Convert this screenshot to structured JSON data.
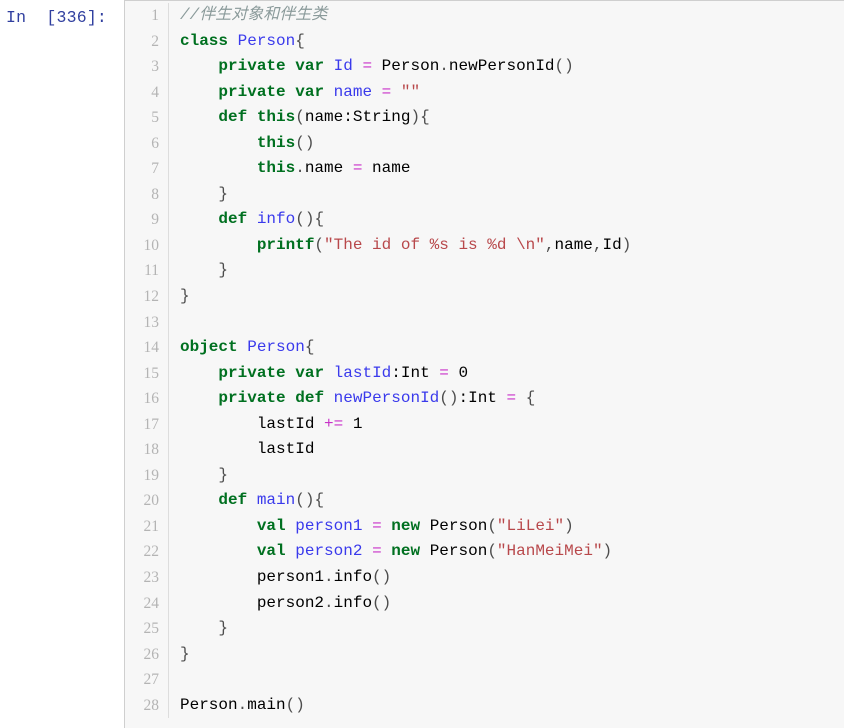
{
  "cell": {
    "prompt": "In  [336]:",
    "language": "scala",
    "line_count": 28,
    "colors": {
      "cell_background": "#f7f7f7",
      "page_background": "#ffffff",
      "prompt_color": "#303F9F",
      "gutter_text": "#b4b4b4",
      "gutter_border": "#dddddd",
      "cell_border": "#cfcfcf",
      "comment": "#8a9a9a",
      "keyword": "#007020",
      "builtin": "#007020",
      "name": "#3a3aec",
      "string": "#b8484b",
      "operator": "#c832c8",
      "plain": "#000000",
      "brace": "#4d4d4d"
    }
  },
  "line_numbers": [
    "1",
    "2",
    "3",
    "4",
    "5",
    "6",
    "7",
    "8",
    "9",
    "10",
    "11",
    "12",
    "13",
    "14",
    "15",
    "16",
    "17",
    "18",
    "19",
    "20",
    "21",
    "22",
    "23",
    "24",
    "25",
    "26",
    "27",
    "28"
  ],
  "code": {
    "plain_text": "//伴生对象和伴生类\nclass Person{\n    private var Id = Person.newPersonId()\n    private var name = \"\"\n    def this(name:String){\n        this()\n        this.name = name\n    }\n    def info(){\n        printf(\"The id of %s is %d \\n\",name,Id)\n    }\n}\n\nobject Person{\n    private var lastId:Int = 0\n    private def newPersonId():Int = {\n        lastId += 1\n        lastId\n    }\n    def main(){\n        val person1 = new Person(\"LiLei\")\n        val person2 = new Person(\"HanMeiMei\")\n        person1.info()\n        person2.info()\n    }\n}\n\nPerson.main()",
    "lines": [
      {
        "n": 1,
        "tokens": [
          {
            "t": "comment",
            "v": "//伴生对象和伴生类"
          }
        ]
      },
      {
        "n": 2,
        "tokens": [
          {
            "t": "keyword",
            "v": "class"
          },
          {
            "t": "plain",
            "v": " "
          },
          {
            "t": "class",
            "v": "Person"
          },
          {
            "t": "brace",
            "v": "{"
          }
        ]
      },
      {
        "n": 3,
        "tokens": [
          {
            "t": "plain",
            "v": "    "
          },
          {
            "t": "keyword",
            "v": "private"
          },
          {
            "t": "plain",
            "v": " "
          },
          {
            "t": "keyword",
            "v": "var"
          },
          {
            "t": "plain",
            "v": " "
          },
          {
            "t": "name",
            "v": "Id"
          },
          {
            "t": "plain",
            "v": " "
          },
          {
            "t": "operator",
            "v": "="
          },
          {
            "t": "plain",
            "v": " Person"
          },
          {
            "t": "punct",
            "v": "."
          },
          {
            "t": "plain",
            "v": "newPersonId"
          },
          {
            "t": "brace",
            "v": "()"
          }
        ]
      },
      {
        "n": 4,
        "tokens": [
          {
            "t": "plain",
            "v": "    "
          },
          {
            "t": "keyword",
            "v": "private"
          },
          {
            "t": "plain",
            "v": " "
          },
          {
            "t": "keyword",
            "v": "var"
          },
          {
            "t": "plain",
            "v": " "
          },
          {
            "t": "name",
            "v": "name"
          },
          {
            "t": "plain",
            "v": " "
          },
          {
            "t": "operator",
            "v": "="
          },
          {
            "t": "plain",
            "v": " "
          },
          {
            "t": "string",
            "v": "\"\""
          }
        ]
      },
      {
        "n": 5,
        "tokens": [
          {
            "t": "plain",
            "v": "    "
          },
          {
            "t": "keyword",
            "v": "def"
          },
          {
            "t": "plain",
            "v": " "
          },
          {
            "t": "keyword",
            "v": "this"
          },
          {
            "t": "brace",
            "v": "("
          },
          {
            "t": "plain",
            "v": "name:String"
          },
          {
            "t": "brace",
            "v": ")"
          },
          {
            "t": "brace",
            "v": "{"
          }
        ]
      },
      {
        "n": 6,
        "tokens": [
          {
            "t": "plain",
            "v": "        "
          },
          {
            "t": "keyword",
            "v": "this"
          },
          {
            "t": "brace",
            "v": "()"
          }
        ]
      },
      {
        "n": 7,
        "tokens": [
          {
            "t": "plain",
            "v": "        "
          },
          {
            "t": "keyword",
            "v": "this"
          },
          {
            "t": "punct",
            "v": "."
          },
          {
            "t": "plain",
            "v": "name "
          },
          {
            "t": "operator",
            "v": "="
          },
          {
            "t": "plain",
            "v": " name"
          }
        ]
      },
      {
        "n": 8,
        "tokens": [
          {
            "t": "plain",
            "v": "    "
          },
          {
            "t": "brace",
            "v": "}"
          }
        ]
      },
      {
        "n": 9,
        "tokens": [
          {
            "t": "plain",
            "v": "    "
          },
          {
            "t": "keyword",
            "v": "def"
          },
          {
            "t": "plain",
            "v": " "
          },
          {
            "t": "name",
            "v": "info"
          },
          {
            "t": "brace",
            "v": "()"
          },
          {
            "t": "brace",
            "v": "{"
          }
        ]
      },
      {
        "n": 10,
        "tokens": [
          {
            "t": "plain",
            "v": "        "
          },
          {
            "t": "builtin",
            "v": "printf"
          },
          {
            "t": "brace",
            "v": "("
          },
          {
            "t": "string",
            "v": "\"The id of %s is %d \\n\""
          },
          {
            "t": "punct",
            "v": ","
          },
          {
            "t": "plain",
            "v": "name"
          },
          {
            "t": "punct",
            "v": ","
          },
          {
            "t": "plain",
            "v": "Id"
          },
          {
            "t": "brace",
            "v": ")"
          }
        ]
      },
      {
        "n": 11,
        "tokens": [
          {
            "t": "plain",
            "v": "    "
          },
          {
            "t": "brace",
            "v": "}"
          }
        ]
      },
      {
        "n": 12,
        "tokens": [
          {
            "t": "brace",
            "v": "}"
          }
        ]
      },
      {
        "n": 13,
        "tokens": []
      },
      {
        "n": 14,
        "tokens": [
          {
            "t": "keyword",
            "v": "object"
          },
          {
            "t": "plain",
            "v": " "
          },
          {
            "t": "class",
            "v": "Person"
          },
          {
            "t": "brace",
            "v": "{"
          }
        ]
      },
      {
        "n": 15,
        "tokens": [
          {
            "t": "plain",
            "v": "    "
          },
          {
            "t": "keyword",
            "v": "private"
          },
          {
            "t": "plain",
            "v": " "
          },
          {
            "t": "keyword",
            "v": "var"
          },
          {
            "t": "plain",
            "v": " "
          },
          {
            "t": "name",
            "v": "lastId"
          },
          {
            "t": "plain",
            "v": ":Int "
          },
          {
            "t": "operator",
            "v": "="
          },
          {
            "t": "plain",
            "v": " "
          },
          {
            "t": "number",
            "v": "0"
          }
        ]
      },
      {
        "n": 16,
        "tokens": [
          {
            "t": "plain",
            "v": "    "
          },
          {
            "t": "keyword",
            "v": "private"
          },
          {
            "t": "plain",
            "v": " "
          },
          {
            "t": "keyword",
            "v": "def"
          },
          {
            "t": "plain",
            "v": " "
          },
          {
            "t": "name",
            "v": "newPersonId"
          },
          {
            "t": "brace",
            "v": "()"
          },
          {
            "t": "plain",
            "v": ":Int "
          },
          {
            "t": "operator",
            "v": "="
          },
          {
            "t": "plain",
            "v": " "
          },
          {
            "t": "brace",
            "v": "{"
          }
        ]
      },
      {
        "n": 17,
        "tokens": [
          {
            "t": "plain",
            "v": "        lastId "
          },
          {
            "t": "operator",
            "v": "+="
          },
          {
            "t": "plain",
            "v": " "
          },
          {
            "t": "number",
            "v": "1"
          }
        ]
      },
      {
        "n": 18,
        "tokens": [
          {
            "t": "plain",
            "v": "        lastId"
          }
        ]
      },
      {
        "n": 19,
        "tokens": [
          {
            "t": "plain",
            "v": "    "
          },
          {
            "t": "brace",
            "v": "}"
          }
        ]
      },
      {
        "n": 20,
        "tokens": [
          {
            "t": "plain",
            "v": "    "
          },
          {
            "t": "keyword",
            "v": "def"
          },
          {
            "t": "plain",
            "v": " "
          },
          {
            "t": "name",
            "v": "main"
          },
          {
            "t": "brace",
            "v": "()"
          },
          {
            "t": "brace",
            "v": "{"
          }
        ]
      },
      {
        "n": 21,
        "tokens": [
          {
            "t": "plain",
            "v": "        "
          },
          {
            "t": "keyword",
            "v": "val"
          },
          {
            "t": "plain",
            "v": " "
          },
          {
            "t": "name",
            "v": "person1"
          },
          {
            "t": "plain",
            "v": " "
          },
          {
            "t": "operator",
            "v": "="
          },
          {
            "t": "plain",
            "v": " "
          },
          {
            "t": "keyword",
            "v": "new"
          },
          {
            "t": "plain",
            "v": " Person"
          },
          {
            "t": "brace",
            "v": "("
          },
          {
            "t": "string",
            "v": "\"LiLei\""
          },
          {
            "t": "brace",
            "v": ")"
          }
        ]
      },
      {
        "n": 22,
        "tokens": [
          {
            "t": "plain",
            "v": "        "
          },
          {
            "t": "keyword",
            "v": "val"
          },
          {
            "t": "plain",
            "v": " "
          },
          {
            "t": "name",
            "v": "person2"
          },
          {
            "t": "plain",
            "v": " "
          },
          {
            "t": "operator",
            "v": "="
          },
          {
            "t": "plain",
            "v": " "
          },
          {
            "t": "keyword",
            "v": "new"
          },
          {
            "t": "plain",
            "v": " Person"
          },
          {
            "t": "brace",
            "v": "("
          },
          {
            "t": "string",
            "v": "\"HanMeiMei\""
          },
          {
            "t": "brace",
            "v": ")"
          }
        ]
      },
      {
        "n": 23,
        "tokens": [
          {
            "t": "plain",
            "v": "        person1"
          },
          {
            "t": "punct",
            "v": "."
          },
          {
            "t": "plain",
            "v": "info"
          },
          {
            "t": "brace",
            "v": "()"
          }
        ]
      },
      {
        "n": 24,
        "tokens": [
          {
            "t": "plain",
            "v": "        person2"
          },
          {
            "t": "punct",
            "v": "."
          },
          {
            "t": "plain",
            "v": "info"
          },
          {
            "t": "brace",
            "v": "()"
          }
        ]
      },
      {
        "n": 25,
        "tokens": [
          {
            "t": "plain",
            "v": "    "
          },
          {
            "t": "brace",
            "v": "}"
          }
        ]
      },
      {
        "n": 26,
        "tokens": [
          {
            "t": "brace",
            "v": "}"
          }
        ]
      },
      {
        "n": 27,
        "tokens": []
      },
      {
        "n": 28,
        "tokens": [
          {
            "t": "plain",
            "v": "Person"
          },
          {
            "t": "punct",
            "v": "."
          },
          {
            "t": "plain",
            "v": "main"
          },
          {
            "t": "brace",
            "v": "()"
          }
        ]
      }
    ]
  }
}
